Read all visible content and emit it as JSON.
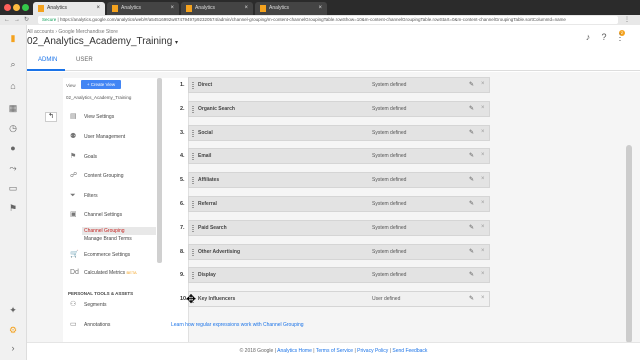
{
  "browser": {
    "tabs": [
      {
        "label": "Analytics"
      },
      {
        "label": "Analytics"
      },
      {
        "label": "Analytics"
      },
      {
        "label": "Analytics"
      }
    ],
    "secure_label": "Secure",
    "url": "https://analytics.google.com/analytics/web/#/a54516992w87479497p92320574/admin/channel-grouping/m-content-channelGroupingTable.rowShow=10&m-content-channelGroupingTable.rowStart=0&m-content-channelGroupingTable.sortColumnId=name"
  },
  "header": {
    "breadcrumb": "All accounts › Google Merchandise Store",
    "property": "02_Analytics_Academy_Training",
    "notification_count": "2"
  },
  "tabs": {
    "admin": "ADMIN",
    "user": "USER"
  },
  "panel": {
    "view_label": "View",
    "create_view": "+ Create View",
    "view_name": "02_Analytics_Academy_Training",
    "items": [
      {
        "label": "View Settings"
      },
      {
        "label": "User Management"
      },
      {
        "label": "Goals"
      },
      {
        "label": "Content Grouping"
      },
      {
        "label": "Filters"
      },
      {
        "label": "Channel Settings"
      }
    ],
    "sub_items": [
      {
        "label": "Channel Grouping"
      },
      {
        "label": "Manage Brand Terms"
      }
    ],
    "items2": [
      {
        "label": "Ecommerce Settings"
      },
      {
        "label": "Calculated Metrics"
      }
    ],
    "calc_beta": "BETA",
    "section_title": "PERSONAL TOOLS & ASSETS",
    "items3": [
      {
        "label": "Segments"
      },
      {
        "label": "Annotations"
      }
    ]
  },
  "rows": [
    {
      "num": "1.",
      "name": "Direct",
      "type": "System defined"
    },
    {
      "num": "2.",
      "name": "Organic Search",
      "type": "System defined"
    },
    {
      "num": "3.",
      "name": "Social",
      "type": "System defined"
    },
    {
      "num": "4.",
      "name": "Email",
      "type": "System defined"
    },
    {
      "num": "5.",
      "name": "Affiliates",
      "type": "System defined"
    },
    {
      "num": "6.",
      "name": "Referral",
      "type": "System defined"
    },
    {
      "num": "7.",
      "name": "Paid Search",
      "type": "System defined"
    },
    {
      "num": "8.",
      "name": "Other Advertising",
      "type": "System defined"
    },
    {
      "num": "9.",
      "name": "Display",
      "type": "System defined"
    },
    {
      "num": "10.",
      "name": "Key Influencers",
      "type": "User defined"
    }
  ],
  "help_link": "Learn how regular expressions work with Channel Grouping",
  "footer": {
    "copyright": "© 2018 Google |",
    "links": [
      "Analytics Home",
      "Terms of Service",
      "Privacy Policy",
      "Send Feedback"
    ]
  },
  "icons": {
    "edit": "pencil-icon",
    "delete": "close-icon"
  },
  "colors": {
    "accent": "#1a73e8",
    "create_button": "#4285f4",
    "logo": "#f4a21e",
    "active_subitem": "#c5221f"
  }
}
